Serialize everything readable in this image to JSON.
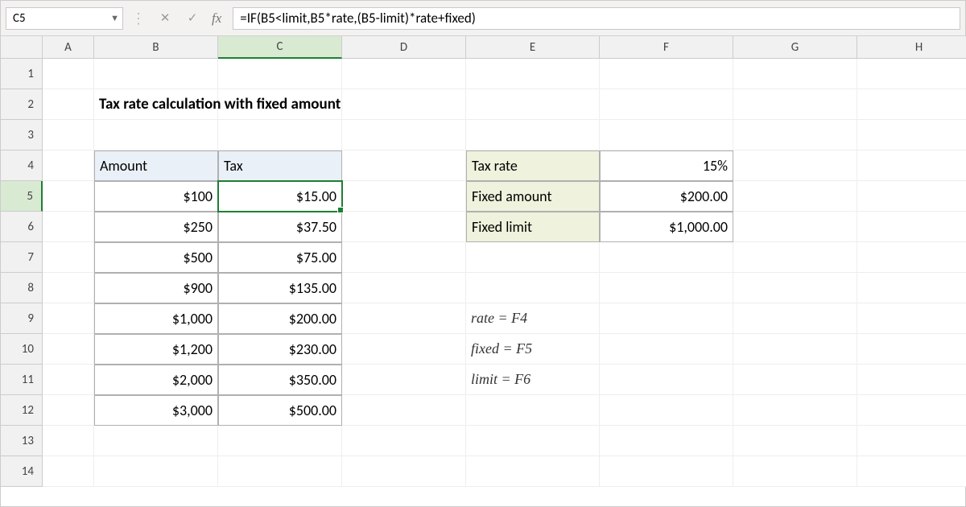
{
  "namebox": {
    "value": "C5"
  },
  "formula": "=IF(B5<limit,B5*rate,(B5-limit)*rate+fixed)",
  "columns": [
    "A",
    "B",
    "C",
    "D",
    "E",
    "F",
    "G",
    "H"
  ],
  "rows": [
    "1",
    "2",
    "3",
    "4",
    "5",
    "6",
    "7",
    "8",
    "9",
    "10",
    "11",
    "12",
    "13",
    "14"
  ],
  "selected": {
    "col": "C",
    "row": "5"
  },
  "title": "Tax rate calculation with fixed amount",
  "table1": {
    "headers": {
      "amount": "Amount",
      "tax": "Tax"
    },
    "rows": [
      {
        "amount": "$100",
        "tax": "$15.00"
      },
      {
        "amount": "$250",
        "tax": "$37.50"
      },
      {
        "amount": "$500",
        "tax": "$75.00"
      },
      {
        "amount": "$900",
        "tax": "$135.00"
      },
      {
        "amount": "$1,000",
        "tax": "$200.00"
      },
      {
        "amount": "$1,200",
        "tax": "$230.00"
      },
      {
        "amount": "$2,000",
        "tax": "$350.00"
      },
      {
        "amount": "$3,000",
        "tax": "$500.00"
      }
    ]
  },
  "params": {
    "rows": [
      {
        "label": "Tax rate",
        "value": "15%"
      },
      {
        "label": "Fixed amount",
        "value": "$200.00"
      },
      {
        "label": "Fixed limit",
        "value": "$1,000.00"
      }
    ]
  },
  "notes": [
    "rate = F4",
    "fixed = F5",
    "limit = F6"
  ],
  "icons": {
    "dropdown": "▼",
    "cancel": "✕",
    "enter": "✓"
  },
  "fx_label": "fx",
  "sep_label": "⋮"
}
